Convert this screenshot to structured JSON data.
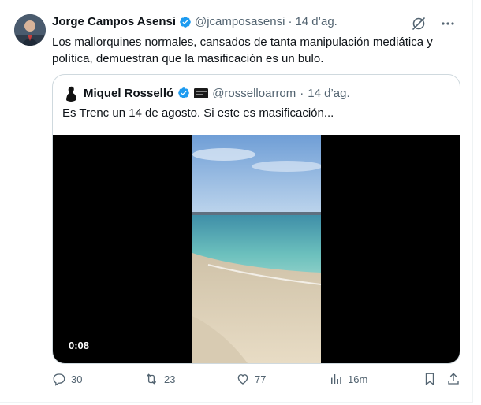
{
  "tweet": {
    "author_name": "Jorge Campos Asensi",
    "handle": "@jcamposasensi",
    "separator": "·",
    "date": "14 d’ag.",
    "text": "Los mallorquines normales, cansados de tanta manipulación mediática y política, demuestran que la masificación es un bulo."
  },
  "quoted": {
    "author_name": "Miquel Rosselló",
    "handle": "@rosselloarrom",
    "separator": "·",
    "date": "14 d’ag.",
    "text": "Es Trenc un 14 de agosto. Si este es masificación...",
    "video_duration": "0:08"
  },
  "actions": {
    "replies": "30",
    "retweets": "23",
    "likes": "77",
    "views": "16m"
  },
  "icons": {
    "verified": "verified-badge-icon",
    "grok": "grok-icon",
    "more": "more-icon",
    "reply": "reply-icon",
    "retweet": "retweet-icon",
    "like": "like-icon",
    "views": "views-icon",
    "bookmark": "bookmark-icon",
    "share": "share-icon"
  },
  "colors": {
    "verified": "#1d9bf0",
    "text": "#0f1419",
    "secondary": "#536471",
    "border": "#cfd9de"
  }
}
